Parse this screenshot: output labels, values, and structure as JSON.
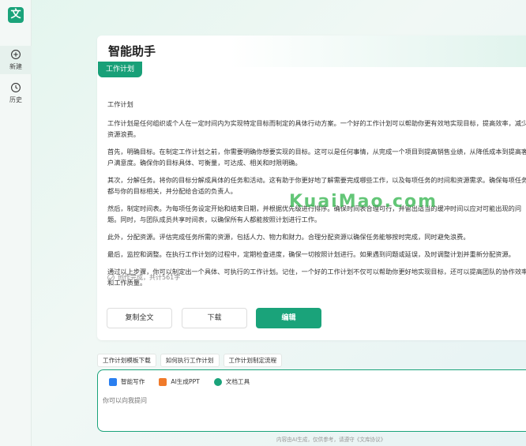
{
  "app": {
    "logo_char": "文"
  },
  "rail": {
    "items": [
      {
        "label": "新建",
        "icon": "new-chat-icon"
      },
      {
        "label": "历史",
        "icon": "history-clock-icon"
      }
    ]
  },
  "header": {
    "title": "智能助手"
  },
  "tag": {
    "label": "工作计划"
  },
  "document": {
    "title": "工作计划",
    "paragraphs": [
      "工作计划是任何组织或个人在一定时间内为实现特定目标而制定的具体行动方案。一个好的工作计划可以帮助你更有效地实现目标，提高效率，减少资源浪费。",
      "首先，明确目标。在制定工作计划之前，你需要明确你想要实现的目标。这可以是任何事情，从完成一个项目到提高销售业绩，从降低成本到提高客户满意度。确保你的目标具体、可衡量，可达成、相关和时限明确。",
      "其次，分解任务。将你的目标分解成具体的任务和活动。这有助于你更好地了解需要完成哪些工作，以及每项任务的时间和资源需求。确保每项任务都与你的目标相关，并分配给合适的负责人。",
      "然后，制定时间表。为每项任务设定开始和结束日期，并根据优先级进行排序。确保时间表合理可行，并留出适当的缓冲时间以应对可能出现的问题。同时，与团队成员共享时间表，以确保所有人都能按照计划进行工作。",
      "此外，分配资源。评估完成任务所需的资源，包括人力、物力和财力。合理分配资源以确保任务能够按时完成，同时避免浪费。",
      "最后，监控和调整。在执行工作计划的过程中，定期检查进度，确保一切按照计划进行。如果遇到问题或延误，及时调整计划并重新分配资源。",
      "通过以上步骤，你可以制定出一个具体、可执行的工作计划。记住，一个好的工作计划不仅可以帮助你更好地实现目标，还可以提高团队的协作效率和工作质量。"
    ],
    "status": "创作完成，共计561字"
  },
  "actions": {
    "copy": "复制全文",
    "download": "下载",
    "edit": "编辑"
  },
  "watermark": "KuaiMao.com",
  "chips": [
    "工作计划模板下载",
    "如何执行工作计划",
    "工作计划制定流程"
  ],
  "tools": [
    {
      "label": "智能写作",
      "color": "#2a7ff0"
    },
    {
      "label": "AI生成PPT",
      "color": "#f07a2a"
    },
    {
      "label": "文档工具",
      "color": "#1aa37a"
    }
  ],
  "input": {
    "placeholder": "你可以向我提问"
  },
  "footer": {
    "note": "内容由AI生成，仅供参考，请遵守《文库协议》"
  },
  "colors": {
    "accent": "#1aa37a"
  }
}
